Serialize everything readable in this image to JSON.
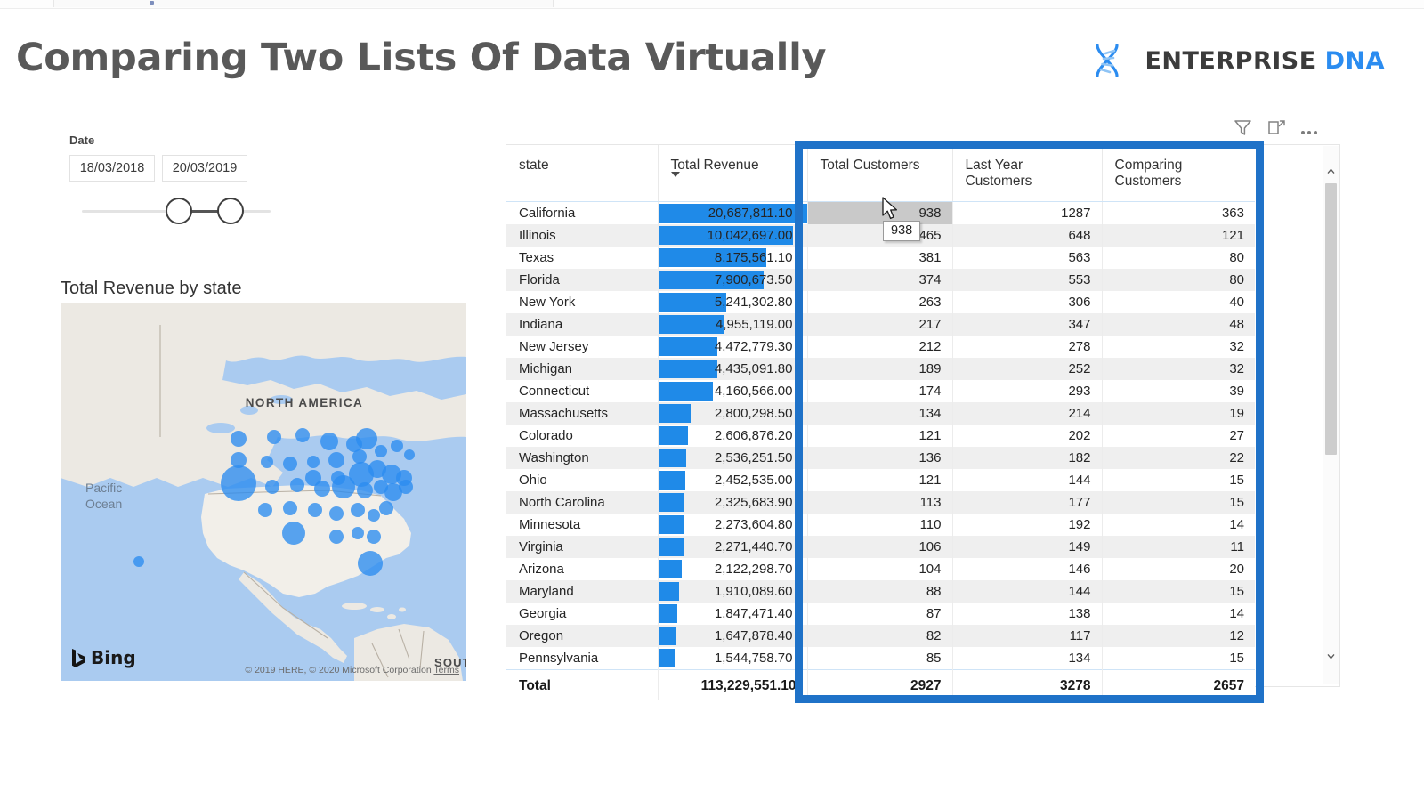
{
  "header": {
    "title": "Comparing Two Lists Of Data Virtually",
    "brand_primary": "ENTERPRISE",
    "brand_secondary": "DNA",
    "brand_icon": "dna-helix-icon",
    "accent_color": "#2b8cf0",
    "title_color": "#595959"
  },
  "slicer": {
    "label": "Date",
    "start_value": "18/03/2018",
    "end_value": "20/03/2019"
  },
  "map": {
    "title": "Total Revenue by state",
    "region_label": "NORTH AMERICA",
    "region_label_2": "SOUTH AMERICA",
    "ocean_label": "Pacific Ocean",
    "provider": "Bing",
    "attribution": "© 2019 HERE, © 2020 Microsoft Corporation",
    "terms": "Terms",
    "bubble_color": "#2b8cf0"
  },
  "visual_header_icons": [
    {
      "name": "filter-icon",
      "label": "Filters"
    },
    {
      "name": "focus-mode-icon",
      "label": "Focus mode"
    },
    {
      "name": "more-options-icon",
      "label": "More options"
    }
  ],
  "table": {
    "columns": [
      {
        "key": "state",
        "label": "state",
        "align": "left"
      },
      {
        "key": "revenue",
        "label": "Total Revenue",
        "align": "right",
        "sorted": true,
        "sort_dir": "desc"
      },
      {
        "key": "total_customers",
        "label": "Total Customers",
        "align": "right"
      },
      {
        "key": "last_year_customers",
        "label": "Last Year Customers",
        "align": "right"
      },
      {
        "key": "comparing_customers",
        "label": "Comparing Customers",
        "align": "right"
      }
    ],
    "rows": [
      {
        "state": "California",
        "revenue": "20,687,811.10",
        "bar_pct": 100,
        "total_customers": "938",
        "last_year_customers": "1287",
        "comparing_customers": "363"
      },
      {
        "state": "Illinois",
        "revenue": "10,042,697.00",
        "bar_pct": 91,
        "total_customers": "465",
        "last_year_customers": "648",
        "comparing_customers": "121"
      },
      {
        "state": "Texas",
        "revenue": "8,175,561.10",
        "bar_pct": 73,
        "total_customers": "381",
        "last_year_customers": "563",
        "comparing_customers": "80"
      },
      {
        "state": "Florida",
        "revenue": "7,900,673.50",
        "bar_pct": 71,
        "total_customers": "374",
        "last_year_customers": "553",
        "comparing_customers": "80"
      },
      {
        "state": "New York",
        "revenue": "5,241,302.80",
        "bar_pct": 46,
        "total_customers": "263",
        "last_year_customers": "306",
        "comparing_customers": "40"
      },
      {
        "state": "Indiana",
        "revenue": "4,955,119.00",
        "bar_pct": 44,
        "total_customers": "217",
        "last_year_customers": "347",
        "comparing_customers": "48"
      },
      {
        "state": "New Jersey",
        "revenue": "4,472,779.30",
        "bar_pct": 40,
        "total_customers": "212",
        "last_year_customers": "278",
        "comparing_customers": "32"
      },
      {
        "state": "Michigan",
        "revenue": "4,435,091.80",
        "bar_pct": 40,
        "total_customers": "189",
        "last_year_customers": "252",
        "comparing_customers": "32"
      },
      {
        "state": "Connecticut",
        "revenue": "4,160,566.00",
        "bar_pct": 37,
        "total_customers": "174",
        "last_year_customers": "293",
        "comparing_customers": "39"
      },
      {
        "state": "Massachusetts",
        "revenue": "2,800,298.50",
        "bar_pct": 22,
        "total_customers": "134",
        "last_year_customers": "214",
        "comparing_customers": "19"
      },
      {
        "state": "Colorado",
        "revenue": "2,606,876.20",
        "bar_pct": 20,
        "total_customers": "121",
        "last_year_customers": "202",
        "comparing_customers": "27"
      },
      {
        "state": "Washington",
        "revenue": "2,536,251.50",
        "bar_pct": 19,
        "total_customers": "136",
        "last_year_customers": "182",
        "comparing_customers": "22"
      },
      {
        "state": "Ohio",
        "revenue": "2,452,535.00",
        "bar_pct": 18,
        "total_customers": "121",
        "last_year_customers": "144",
        "comparing_customers": "15"
      },
      {
        "state": "North Carolina",
        "revenue": "2,325,683.90",
        "bar_pct": 17,
        "total_customers": "113",
        "last_year_customers": "177",
        "comparing_customers": "15"
      },
      {
        "state": "Minnesota",
        "revenue": "2,273,604.80",
        "bar_pct": 17,
        "total_customers": "110",
        "last_year_customers": "192",
        "comparing_customers": "14"
      },
      {
        "state": "Virginia",
        "revenue": "2,271,440.70",
        "bar_pct": 17,
        "total_customers": "106",
        "last_year_customers": "149",
        "comparing_customers": "11"
      },
      {
        "state": "Arizona",
        "revenue": "2,122,298.70",
        "bar_pct": 16,
        "total_customers": "104",
        "last_year_customers": "146",
        "comparing_customers": "20"
      },
      {
        "state": "Maryland",
        "revenue": "1,910,089.60",
        "bar_pct": 14,
        "total_customers": "88",
        "last_year_customers": "144",
        "comparing_customers": "15"
      },
      {
        "state": "Georgia",
        "revenue": "1,847,471.40",
        "bar_pct": 13,
        "total_customers": "87",
        "last_year_customers": "138",
        "comparing_customers": "14"
      },
      {
        "state": "Oregon",
        "revenue": "1,647,878.40",
        "bar_pct": 12,
        "total_customers": "82",
        "last_year_customers": "117",
        "comparing_customers": "12"
      },
      {
        "state": "Pennsylvania",
        "revenue": "1,544,758.70",
        "bar_pct": 11,
        "total_customers": "85",
        "last_year_customers": "134",
        "comparing_customers": "15"
      }
    ],
    "total_row": {
      "state": "Total",
      "revenue": "113,229,551.10",
      "total_customers": "2927",
      "last_year_customers": "3278",
      "comparing_customers": "2657"
    },
    "bar_color": "#1f8ae8",
    "hovered_cell_value": "938"
  },
  "tooltip": {
    "value": "938"
  },
  "highlight": {
    "color": "#1f72c8"
  }
}
